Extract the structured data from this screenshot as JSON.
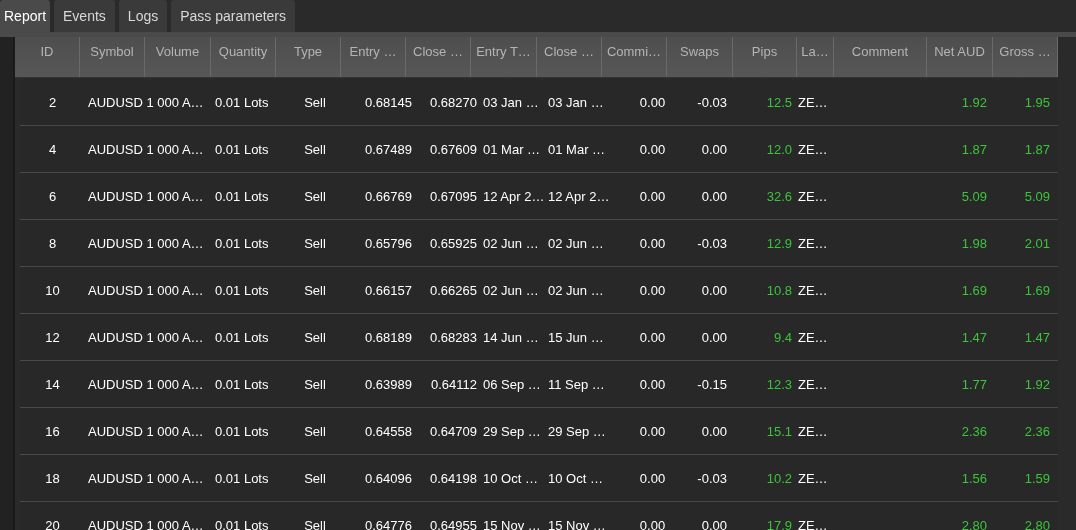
{
  "tabs": [
    {
      "label": "Report",
      "selected": true
    },
    {
      "label": "Events",
      "selected": false
    },
    {
      "label": "Logs",
      "selected": false
    },
    {
      "label": "Pass parameters",
      "selected": false
    }
  ],
  "table": {
    "columns": [
      "ID",
      "Symbol",
      "Volume",
      "Quantity",
      "Type",
      "Entry …",
      "Close …",
      "Entry T…",
      "Close …",
      "Commi…",
      "Swaps",
      "Pips",
      "La…",
      "Comment",
      "Net AUD",
      "Gross …"
    ],
    "rows": [
      {
        "id": "2",
        "symbol": "AUDUSD 1 000 A…",
        "quantity": "0.01 Lots",
        "type": "Sell",
        "entry": "0.68145",
        "close": "0.68270",
        "entry_time": "03 Jan …",
        "close_time": "03 Jan …",
        "commission": "0.00",
        "swaps": "-0.03",
        "pips": "12.5",
        "label": "ZE…",
        "net": "1.92",
        "gross": "1.95"
      },
      {
        "id": "4",
        "symbol": "AUDUSD 1 000 A…",
        "quantity": "0.01 Lots",
        "type": "Sell",
        "entry": "0.67489",
        "close": "0.67609",
        "entry_time": "01 Mar …",
        "close_time": "01 Mar …",
        "commission": "0.00",
        "swaps": "0.00",
        "pips": "12.0",
        "label": "ZE…",
        "net": "1.87",
        "gross": "1.87"
      },
      {
        "id": "6",
        "symbol": "AUDUSD 1 000 A…",
        "quantity": "0.01 Lots",
        "type": "Sell",
        "entry": "0.66769",
        "close": "0.67095",
        "entry_time": "12 Apr 2…",
        "close_time": "12 Apr 2…",
        "commission": "0.00",
        "swaps": "0.00",
        "pips": "32.6",
        "label": "ZE…",
        "net": "5.09",
        "gross": "5.09"
      },
      {
        "id": "8",
        "symbol": "AUDUSD 1 000 A…",
        "quantity": "0.01 Lots",
        "type": "Sell",
        "entry": "0.65796",
        "close": "0.65925",
        "entry_time": "02 Jun …",
        "close_time": "02 Jun …",
        "commission": "0.00",
        "swaps": "-0.03",
        "pips": "12.9",
        "label": "ZE…",
        "net": "1.98",
        "gross": "2.01"
      },
      {
        "id": "10",
        "symbol": "AUDUSD 1 000 A…",
        "quantity": "0.01 Lots",
        "type": "Sell",
        "entry": "0.66157",
        "close": "0.66265",
        "entry_time": "02 Jun …",
        "close_time": "02 Jun …",
        "commission": "0.00",
        "swaps": "0.00",
        "pips": "10.8",
        "label": "ZE…",
        "net": "1.69",
        "gross": "1.69"
      },
      {
        "id": "12",
        "symbol": "AUDUSD 1 000 A…",
        "quantity": "0.01 Lots",
        "type": "Sell",
        "entry": "0.68189",
        "close": "0.68283",
        "entry_time": "14 Jun …",
        "close_time": "15 Jun …",
        "commission": "0.00",
        "swaps": "0.00",
        "pips": "9.4",
        "label": "ZE…",
        "net": "1.47",
        "gross": "1.47"
      },
      {
        "id": "14",
        "symbol": "AUDUSD 1 000 A…",
        "quantity": "0.01 Lots",
        "type": "Sell",
        "entry": "0.63989",
        "close": "0.64112",
        "entry_time": "06 Sep …",
        "close_time": "11 Sep …",
        "commission": "0.00",
        "swaps": "-0.15",
        "pips": "12.3",
        "label": "ZE…",
        "net": "1.77",
        "gross": "1.92"
      },
      {
        "id": "16",
        "symbol": "AUDUSD 1 000 A…",
        "quantity": "0.01 Lots",
        "type": "Sell",
        "entry": "0.64558",
        "close": "0.64709",
        "entry_time": "29 Sep …",
        "close_time": "29 Sep …",
        "commission": "0.00",
        "swaps": "0.00",
        "pips": "15.1",
        "label": "ZE…",
        "net": "2.36",
        "gross": "2.36"
      },
      {
        "id": "18",
        "symbol": "AUDUSD 1 000 A…",
        "quantity": "0.01 Lots",
        "type": "Sell",
        "entry": "0.64096",
        "close": "0.64198",
        "entry_time": "10 Oct …",
        "close_time": "10 Oct …",
        "commission": "0.00",
        "swaps": "-0.03",
        "pips": "10.2",
        "label": "ZE…",
        "net": "1.56",
        "gross": "1.59"
      },
      {
        "id": "20",
        "symbol": "AUDUSD 1 000 A…",
        "quantity": "0.01 Lots",
        "type": "Sell",
        "entry": "0.64776",
        "close": "0.64955",
        "entry_time": "15 Nov …",
        "close_time": "15 Nov …",
        "commission": "0.00",
        "swaps": "0.00",
        "pips": "17.9",
        "label": "ZE…",
        "net": "2.80",
        "gross": "2.80"
      }
    ]
  }
}
